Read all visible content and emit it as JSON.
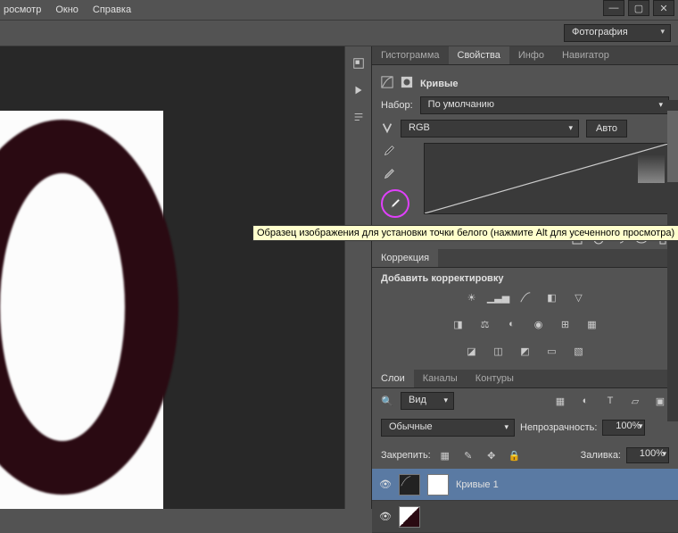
{
  "menu": {
    "items": [
      "росмотр",
      "Окно",
      "Справка"
    ]
  },
  "options": {
    "workspace": "Фотография"
  },
  "panels": {
    "info_tabs": [
      "Гистограмма",
      "Свойства",
      "Инфо",
      "Навигатор"
    ],
    "info_active": 1,
    "properties": {
      "title": "Кривые",
      "preset_label": "Набор:",
      "preset_value": "По умолчанию",
      "channel_value": "RGB",
      "auto_btn": "Авто"
    },
    "adjustments": {
      "tab": "Коррекция",
      "heading": "Добавить корректировку"
    },
    "layers": {
      "tabs": [
        "Слои",
        "Каналы",
        "Контуры"
      ],
      "active": 0,
      "filter_label": "Вид",
      "blend_mode": "Обычные",
      "opacity_label": "Непрозрачность:",
      "opacity_value": "100%",
      "lock_label": "Закрепить:",
      "fill_label": "Заливка:",
      "fill_value": "100%",
      "items": [
        {
          "name": "Кривые 1",
          "selected": true,
          "type": "adjustment"
        },
        {
          "name": "",
          "selected": false,
          "type": "image"
        }
      ]
    }
  },
  "tooltip": "Образец изображения для установки точки белого (нажмите Alt для усеченного просмотра)"
}
